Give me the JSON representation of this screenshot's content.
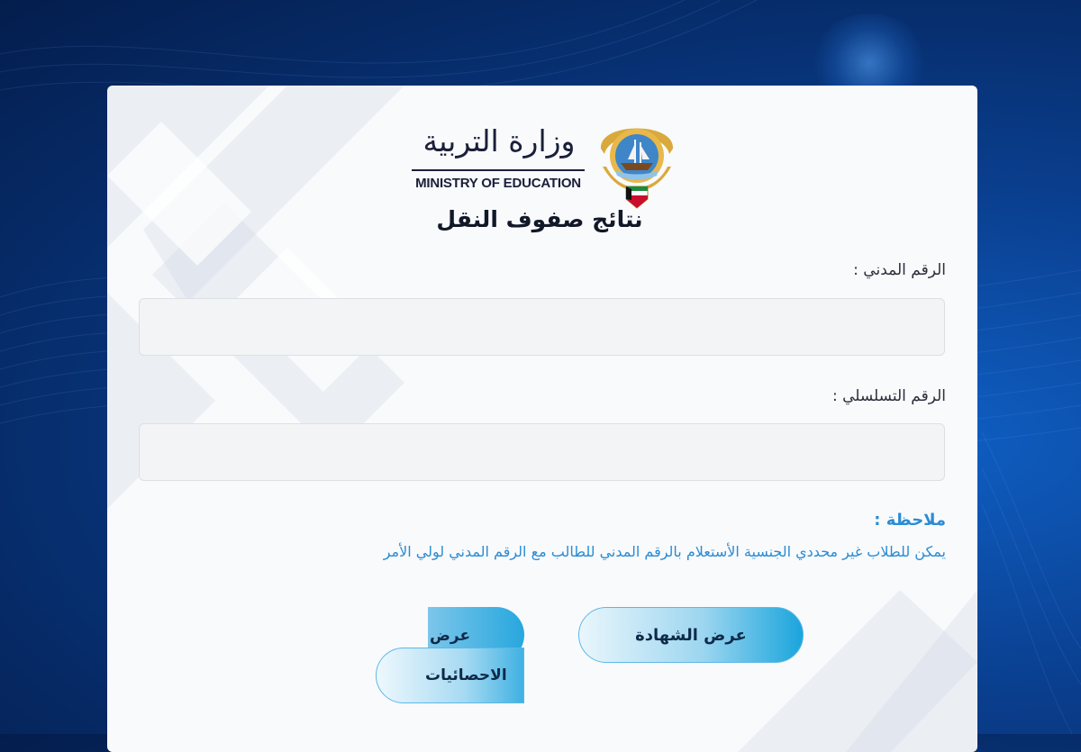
{
  "header": {
    "ministry_ar": "وزارة التربية",
    "ministry_en": "MINISTRY OF EDUCATION",
    "page_title": "نتائج صفوف النقل"
  },
  "form": {
    "civil_id_label": "الرقم المدني :",
    "civil_id_value": "",
    "serial_label": "الرقم التسلسلي :",
    "serial_value": ""
  },
  "note": {
    "title": "ملاحظة :",
    "text": "يمكن للطلاب غير محددي الجنسية الأستعلام بالرقم المدني للطالب مع الرقم المدني لولي الأمر"
  },
  "buttons": {
    "show_certificate": "عرض الشهادة",
    "show_stats_line1": "عرض",
    "show_stats_line2": "الاحصائيات"
  },
  "colors": {
    "accent_blue": "#2a8cd4",
    "background_navy": "#062a66",
    "button_gradient_end": "#1aa5dc"
  },
  "icons": {
    "logo": "kuwait-emblem-icon"
  }
}
